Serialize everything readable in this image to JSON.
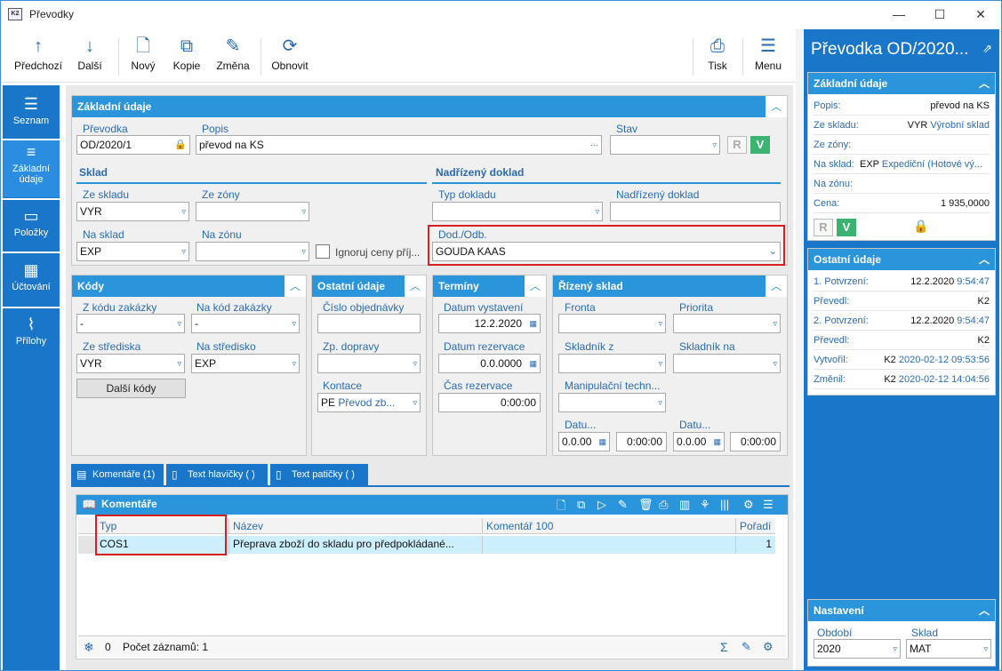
{
  "window": {
    "title": "Převodky",
    "minimize": "—",
    "maximize": "☐",
    "close": "✕"
  },
  "toolbar": {
    "prev": "Předchozí",
    "next": "Další",
    "new": "Nový",
    "copy": "Kopie",
    "edit": "Změna",
    "refresh": "Obnovit",
    "print": "Tisk",
    "menu": "Menu"
  },
  "nav": [
    {
      "label": "Seznam"
    },
    {
      "label": "Základní údaje"
    },
    {
      "label": "Položky"
    },
    {
      "label": "Účtování"
    },
    {
      "label": "Přílohy"
    }
  ],
  "basic": {
    "title": "Základní údaje",
    "prevodka_label": "Převodka",
    "prevodka_value": "OD/2020/1",
    "popis_label": "Popis",
    "popis_value": "převod na KS",
    "stav_label": "Stav",
    "r": "R",
    "v": "V",
    "sklad_title": "Sklad",
    "ze_skladu_label": "Ze skladu",
    "ze_skladu_value": "VYR",
    "ze_zony_label": "Ze zóny",
    "na_sklad_label": "Na sklad",
    "na_sklad_value": "EXP",
    "na_zonu_label": "Na zónu",
    "ignoruj": "Ignoruj ceny příj...",
    "nadrizeny_title": "Nadřízený doklad",
    "typ_dokladu_label": "Typ dokladu",
    "nadrizeny_label": "Nadřízený doklad",
    "dododb_label": "Dod./Odb.",
    "dododb_value": "GOUDA KAAS"
  },
  "kody": {
    "title": "Kódy",
    "z_kodu_label": "Z kódu zakázky",
    "z_kodu_value": "-",
    "na_kod_label": "Na kód zakázky",
    "na_kod_value": "-",
    "ze_strediska_label": "Ze střediska",
    "ze_strediska_value": "VYR",
    "na_stredisko_label": "Na středisko",
    "na_stredisko_value": "EXP",
    "dalsi_kody": "Další kódy"
  },
  "ostatni": {
    "title": "Ostatní údaje",
    "cislo_obj_label": "Číslo objednávky",
    "zp_dopravy_label": "Zp. dopravy",
    "kontace_label": "Kontace",
    "kontace_value": "PE",
    "kontace_link": "Převod zb..."
  },
  "terminy": {
    "title": "Termíny",
    "datum_vyst_label": "Datum vystavení",
    "datum_vyst_value": "12.2.2020",
    "datum_rez_label": "Datum rezervace",
    "datum_rez_value": "0.0.0000",
    "cas_rez_label": "Čas rezervace",
    "cas_rez_value": "0:00:00"
  },
  "rizeny": {
    "title": "Řízený sklad",
    "fronta_label": "Fronta",
    "priorita_label": "Priorita",
    "skladnik_z_label": "Skladník z",
    "skladnik_na_label": "Skladník na",
    "manip_label": "Manipulační techn...",
    "datu1_label": "Datu...",
    "datu2_label": "Datu...",
    "d1": "0.0.00",
    "t1": "0:00:00",
    "d2": "0.0.00",
    "t2": "0:00:00"
  },
  "tabs": [
    {
      "label": "Komentáře (1)"
    },
    {
      "label": "Text hlavičky ( )"
    },
    {
      "label": "Text patičky ( )"
    }
  ],
  "comments": {
    "title": "Komentáře",
    "cols": [
      "Typ",
      "Název",
      "Komentář 100",
      "Pořadí"
    ],
    "rows": [
      {
        "typ": "COS1",
        "nazev": "Přeprava zboží do skladu pro předpokládané...",
        "komentar": "",
        "poradi": "1"
      }
    ],
    "footer_count": "0",
    "footer_records": "Počet záznamů: 1"
  },
  "right": {
    "title": "Převodka OD/2020...",
    "basic_title": "Základní údaje",
    "popis_k": "Popis:",
    "popis_v": "převod na KS",
    "ze_skladu_k": "Ze skladu:",
    "ze_skladu_code": "VYR",
    "ze_skladu_link": "Výrobní sklad",
    "ze_zony_k": "Ze zóny:",
    "na_sklad_k": "Na sklad:",
    "na_sklad_code": "EXP",
    "na_sklad_link": "Expediční (Hotové vý...",
    "na_zonu_k": "Na zónu:",
    "cena_k": "Cena:",
    "cena_v": "1 935,0000",
    "r": "R",
    "v": "V",
    "other_title": "Ostatní údaje",
    "p1_k": "1. Potvrzení:",
    "p1_date": "12.2.2020",
    "p1_time": "9:54:47",
    "prevedl1_k": "Převedl:",
    "prevedl1_v": "K2",
    "p2_k": "2. Potvrzení:",
    "p2_date": "12.2.2020",
    "p2_time": "9:54:47",
    "prevedl2_k": "Převedl:",
    "prevedl2_v": "K2",
    "vytvoril_k": "Vytvořil:",
    "vytvoril_u": "K2",
    "vytvoril_d": "2020-02-12 09:53:56",
    "zmenil_k": "Změnil:",
    "zmenil_u": "K2",
    "zmenil_d": "2020-02-12 14:04:56",
    "settings_title": "Nastavení",
    "obdobi_label": "Období",
    "obdobi_value": "2020",
    "sklad_label": "Sklad",
    "sklad_value": "MAT"
  },
  "colors": {
    "accent": "#2b95dc",
    "nav": "#1976c9",
    "highlight": "#d62020",
    "green": "#3cb371"
  }
}
